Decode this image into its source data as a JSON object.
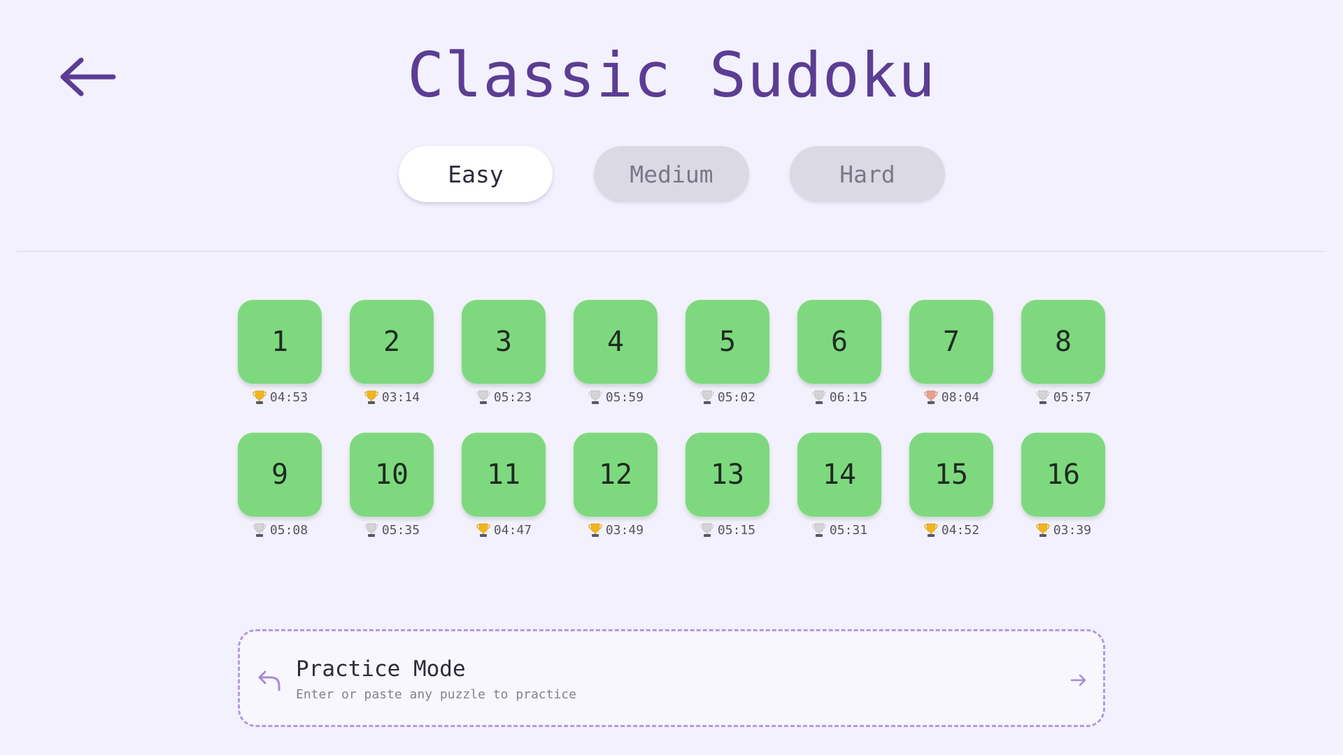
{
  "header": {
    "title": "Classic Sudoku",
    "back_icon": "arrow-left-icon"
  },
  "colors": {
    "accent": "#5b3d93",
    "level_completed": "#7ed97e",
    "background": "#f3f1fd",
    "trophy_gold": "#f2b51f",
    "trophy_silver": "#d4d4d8",
    "trophy_bronze": "#e4a08a",
    "practice_border": "#b49ae0"
  },
  "difficulty": {
    "selected": "Easy",
    "tabs": [
      {
        "label": "Easy",
        "active": true
      },
      {
        "label": "Medium",
        "active": false
      },
      {
        "label": "Hard",
        "active": false
      }
    ]
  },
  "levels": [
    {
      "number": "1",
      "time": "04:53",
      "trophy": "gold"
    },
    {
      "number": "2",
      "time": "03:14",
      "trophy": "gold"
    },
    {
      "number": "3",
      "time": "05:23",
      "trophy": "silver"
    },
    {
      "number": "4",
      "time": "05:59",
      "trophy": "silver"
    },
    {
      "number": "5",
      "time": "05:02",
      "trophy": "silver"
    },
    {
      "number": "6",
      "time": "06:15",
      "trophy": "silver"
    },
    {
      "number": "7",
      "time": "08:04",
      "trophy": "bronze"
    },
    {
      "number": "8",
      "time": "05:57",
      "trophy": "silver"
    },
    {
      "number": "9",
      "time": "05:08",
      "trophy": "silver"
    },
    {
      "number": "10",
      "time": "05:35",
      "trophy": "silver"
    },
    {
      "number": "11",
      "time": "04:47",
      "trophy": "gold"
    },
    {
      "number": "12",
      "time": "03:49",
      "trophy": "gold"
    },
    {
      "number": "13",
      "time": "05:15",
      "trophy": "silver"
    },
    {
      "number": "14",
      "time": "05:31",
      "trophy": "silver"
    },
    {
      "number": "15",
      "time": "04:52",
      "trophy": "gold"
    },
    {
      "number": "16",
      "time": "03:39",
      "trophy": "gold"
    }
  ],
  "practice": {
    "title": "Practice Mode",
    "subtitle": "Enter or paste any puzzle to practice",
    "icon": "undo-arrow-icon",
    "arrow_icon": "arrow-right-icon"
  }
}
